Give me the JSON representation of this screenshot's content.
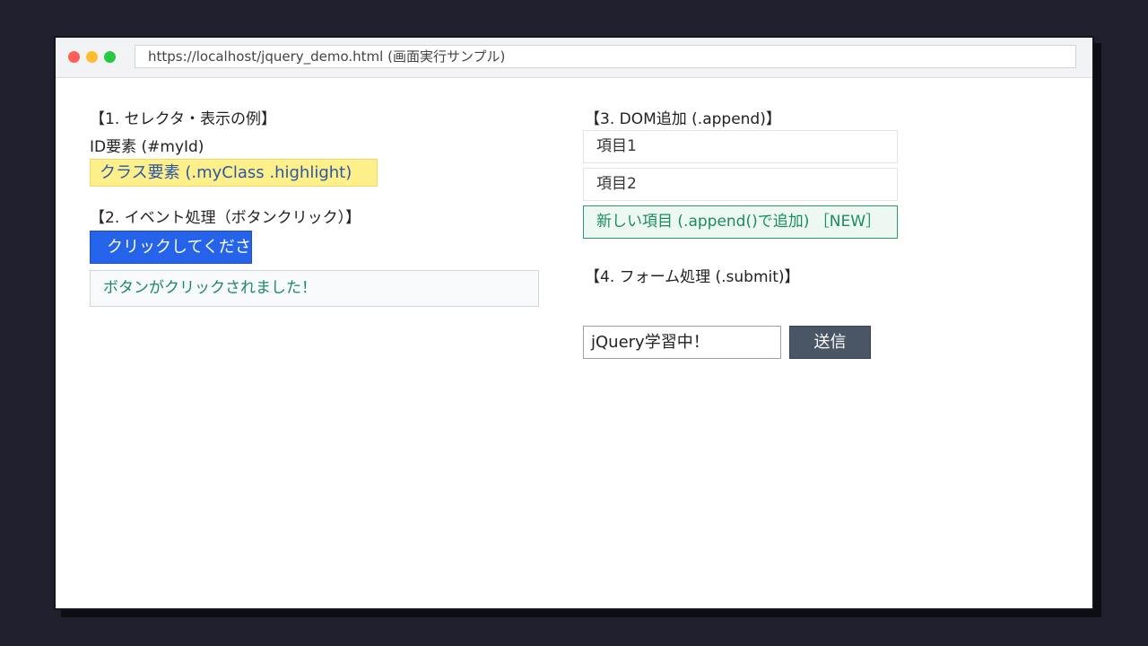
{
  "browser": {
    "url": "https://localhost/jquery_demo.html (画面実行サンプル)"
  },
  "section1": {
    "heading": "【1. セレクタ・表示の例】",
    "id_element": "ID要素 (#myId)",
    "class_element": "クラス要素 (.myClass .highlight)"
  },
  "section2": {
    "heading": "【2. イベント処理（ボタンクリック）】",
    "button_label": "クリックしてください",
    "result_text": "ボタンがクリックされました！"
  },
  "section3": {
    "heading": "【3. DOM追加 (.append)】",
    "items": [
      "項目1",
      "項目2",
      "新しい項目 (.append()で追加) ［NEW］"
    ]
  },
  "section4": {
    "heading": "【4. フォーム処理 (.submit)】",
    "input_value": "jQuery学習中！",
    "submit_label": "送信"
  }
}
